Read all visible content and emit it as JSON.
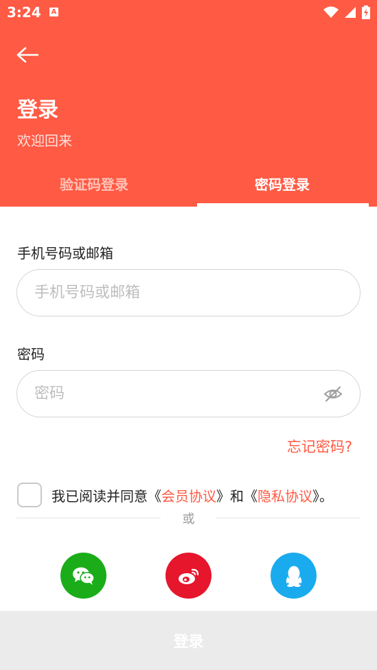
{
  "status_bar": {
    "time": "3:24",
    "notification_badge": "A",
    "icons": [
      "wifi-icon",
      "signal-icon",
      "battery-charging-icon"
    ]
  },
  "header": {
    "title": "登录",
    "subtitle": "欢迎回来",
    "background_color": "#FF5A44"
  },
  "tabs": [
    {
      "label": "验证码登录",
      "active": false
    },
    {
      "label": "密码登录",
      "active": true
    }
  ],
  "form": {
    "account_label": "手机号码或邮箱",
    "account_placeholder": "手机号码或邮箱",
    "password_label": "密码",
    "password_placeholder": "密码",
    "forgot_password": "忘记密码?"
  },
  "agreement": {
    "prefix": "我已阅读并同意《",
    "member_agreement": "会员协议",
    "middle": "》和《",
    "privacy_agreement": "隐私协议",
    "suffix": "》。"
  },
  "divider": {
    "text": "或"
  },
  "social_logins": [
    {
      "name": "wechat",
      "color": "#1AAD19"
    },
    {
      "name": "weibo",
      "color": "#E6162D"
    },
    {
      "name": "qq",
      "color": "#1AABEE"
    }
  ],
  "login_button": {
    "label": "登录"
  }
}
